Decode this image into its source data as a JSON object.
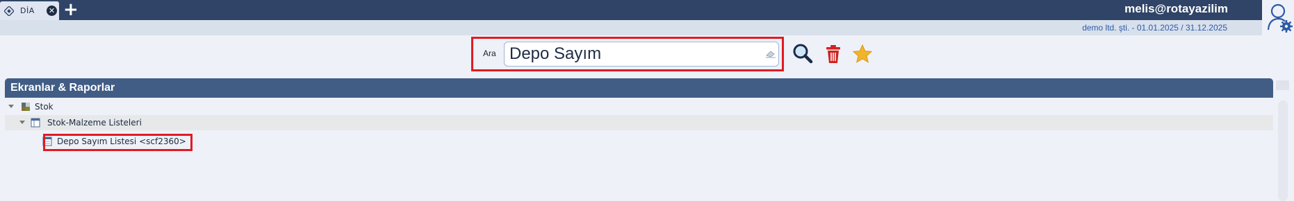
{
  "tab": {
    "label": "DİA",
    "close_icon": "close-circle-icon",
    "add_icon": "plus-icon"
  },
  "user": {
    "name": "melis@rotayazilim",
    "company": "demo ltd. şti. - 01.01.2025 / 31.12.2025",
    "avatar_icon": "user-settings-icon"
  },
  "search": {
    "label": "Ara",
    "value": "Depo Sayım",
    "clear_icon": "eraser-icon",
    "buttons": [
      "search-icon",
      "trash-icon",
      "star-icon"
    ]
  },
  "panel": {
    "title": "Ekranlar & Raporlar"
  },
  "tree": {
    "root": {
      "label": "Stok",
      "expanded": true
    },
    "group": {
      "label": "Stok-Malzeme Listeleri",
      "expanded": true
    },
    "item": {
      "label": "Depo Sayım Listesi <scf2360>"
    }
  },
  "colors": {
    "topbar": "#2f4466",
    "panel_header": "#415d85",
    "highlight_border": "#e11b22",
    "trash": "#d0231f",
    "star": "#f2b42a"
  }
}
